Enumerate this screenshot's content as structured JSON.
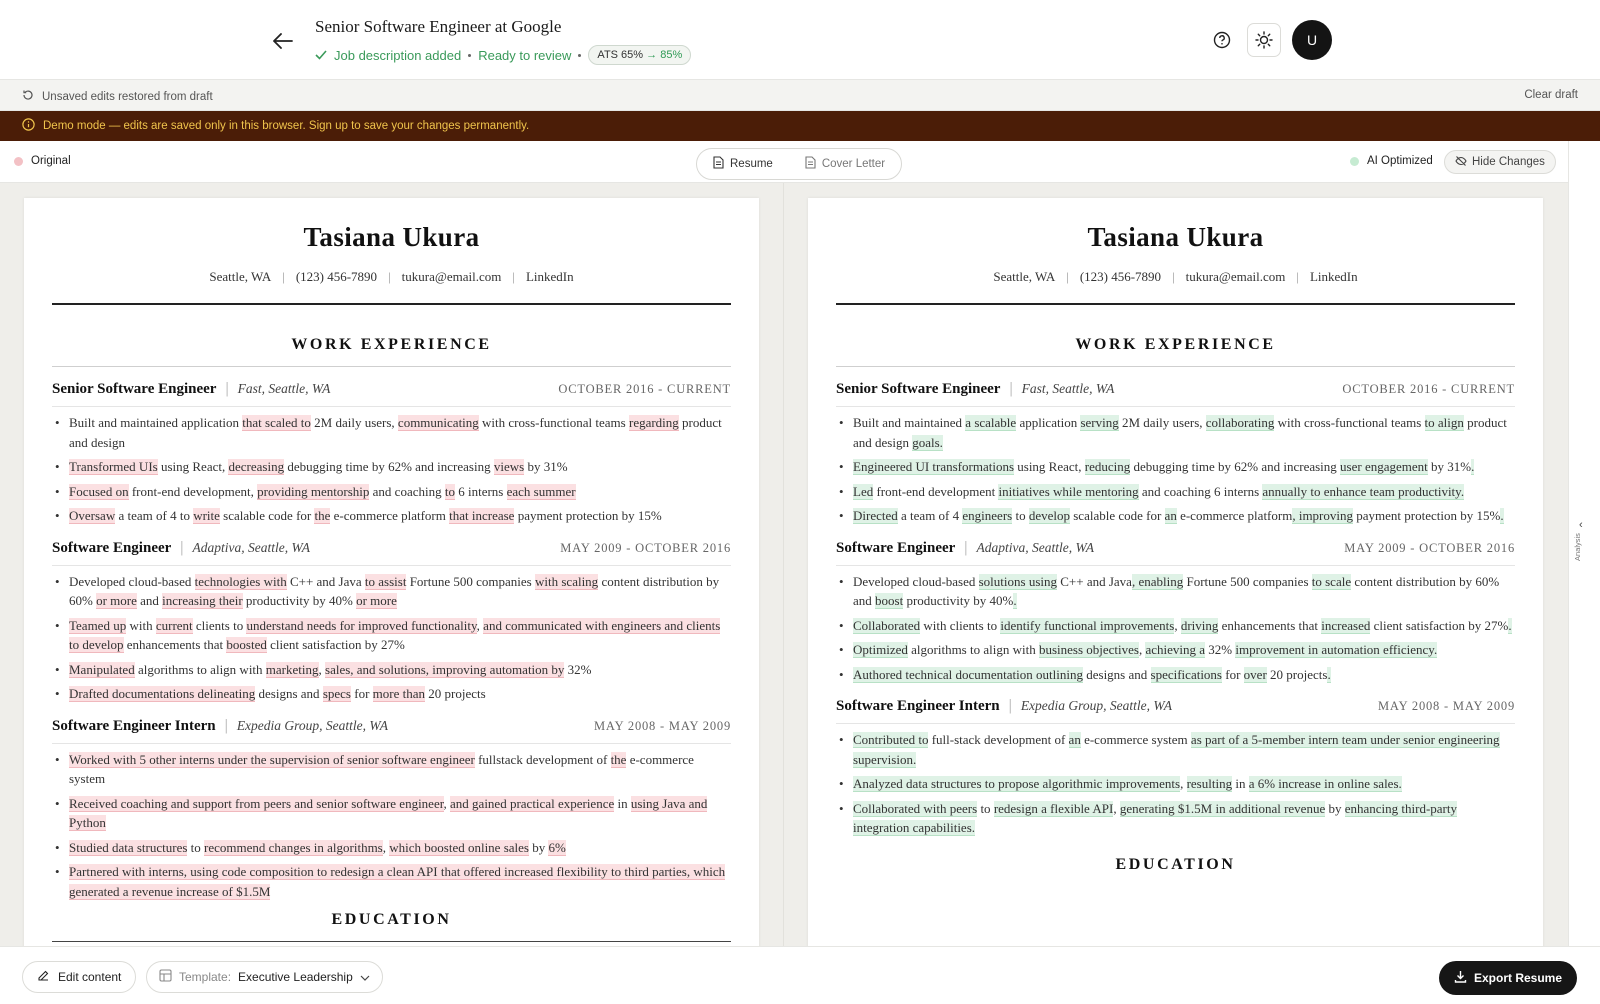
{
  "header": {
    "title": "Senior Software Engineer at Google",
    "status_jd": "Job description added",
    "status_ready": "Ready to review",
    "ats_label": "ATS 65%",
    "ats_arrow": "→",
    "ats_new": "85%",
    "avatar": "U"
  },
  "draft": {
    "message": "Unsaved edits restored from draft",
    "clear": "Clear draft"
  },
  "demo": {
    "message": "Demo mode — edits are saved only in this browser. Sign up to save your changes permanently."
  },
  "toolbar": {
    "original": "Original",
    "tab_resume": "Resume",
    "tab_cover": "Cover Letter",
    "ai": "AI Optimized",
    "hide": "Hide Changes",
    "original_dot": "#f3c1c5",
    "ai_dot": "#c6ebd2"
  },
  "rail": {
    "label": "Analysis"
  },
  "resume": {
    "name": "Tasiana Ukura",
    "contact": [
      "Seattle, WA",
      "(123) 456-7890",
      "tukura@email.com",
      "LinkedIn"
    ],
    "sections": [
      "WORK EXPERIENCE",
      "EDUCATION"
    ]
  },
  "original_jobs": [
    {
      "title": "Senior Software Engineer",
      "company": "Fast, Seattle, WA",
      "dates": "OCTOBER 2016 - CURRENT",
      "bullets": [
        [
          [
            "Built and maintained application ",
            ""
          ],
          [
            "that scaled to",
            "d"
          ],
          [
            " 2M daily users, ",
            ""
          ],
          [
            "communicating",
            "d"
          ],
          [
            " with cross-functional teams ",
            ""
          ],
          [
            "regarding",
            "d"
          ],
          [
            " product and design",
            ""
          ]
        ],
        [
          [
            "Transformed UIs",
            "d"
          ],
          [
            " using React, ",
            ""
          ],
          [
            "decreasing",
            "d"
          ],
          [
            " debugging time by 62% and increasing ",
            ""
          ],
          [
            "views",
            "d"
          ],
          [
            " by 31%",
            ""
          ]
        ],
        [
          [
            "Focused on",
            "d"
          ],
          [
            " front-end development, ",
            ""
          ],
          [
            "providing mentorship",
            "d"
          ],
          [
            " and coaching ",
            ""
          ],
          [
            "to",
            "d"
          ],
          [
            " 6 interns ",
            ""
          ],
          [
            "each summer",
            "d"
          ]
        ],
        [
          [
            "Oversaw",
            "d"
          ],
          [
            " a team of 4 to ",
            ""
          ],
          [
            "write",
            "d"
          ],
          [
            " scalable code for ",
            ""
          ],
          [
            "the",
            "d"
          ],
          [
            " e-commerce platform ",
            ""
          ],
          [
            "that increase",
            "d"
          ],
          [
            " payment protection by 15%",
            ""
          ]
        ]
      ]
    },
    {
      "title": "Software Engineer",
      "company": "Adaptiva, Seattle, WA",
      "dates": "MAY 2009 - OCTOBER 2016",
      "bullets": [
        [
          [
            "Developed cloud-based ",
            ""
          ],
          [
            "technologies with",
            "d"
          ],
          [
            " C++ and Java ",
            ""
          ],
          [
            "to assist",
            "d"
          ],
          [
            " Fortune 500 companies ",
            ""
          ],
          [
            "with scaling",
            "d"
          ],
          [
            " content distribution by 60% ",
            ""
          ],
          [
            "or more",
            "d"
          ],
          [
            " and ",
            ""
          ],
          [
            "increasing their",
            "d"
          ],
          [
            " productivity by 40% ",
            ""
          ],
          [
            "or more",
            "d"
          ]
        ],
        [
          [
            "Teamed up",
            "d"
          ],
          [
            " with ",
            ""
          ],
          [
            "current",
            "d"
          ],
          [
            " clients to ",
            ""
          ],
          [
            "understand needs for improved functionality",
            "d"
          ],
          [
            ", ",
            ""
          ],
          [
            "and communicated with engineers and clients to develop",
            "d"
          ],
          [
            " enhancements that ",
            ""
          ],
          [
            "boosted",
            "d"
          ],
          [
            " client satisfaction by 27%",
            ""
          ]
        ],
        [
          [
            "Manipulated",
            "d"
          ],
          [
            " algorithms to align with ",
            ""
          ],
          [
            "marketing",
            "d"
          ],
          [
            ", ",
            ""
          ],
          [
            "sales, and solutions, improving automation by",
            "d"
          ],
          [
            " 32%",
            ""
          ]
        ],
        [
          [
            "Drafted documentations delineating",
            "d"
          ],
          [
            " designs and ",
            ""
          ],
          [
            "specs",
            "d"
          ],
          [
            " for ",
            ""
          ],
          [
            "more than",
            "d"
          ],
          [
            " 20 projects",
            ""
          ]
        ]
      ]
    },
    {
      "title": "Software Engineer Intern",
      "company": "Expedia Group, Seattle, WA",
      "dates": "MAY 2008 - MAY 2009",
      "bullets": [
        [
          [
            "Worked with 5 other interns under the supervision of senior software engineer",
            "d"
          ],
          [
            " fullstack development of ",
            ""
          ],
          [
            "the",
            "d"
          ],
          [
            " e-commerce system",
            ""
          ]
        ],
        [
          [
            "Received coaching and support from peers and senior software engineer",
            "d"
          ],
          [
            ", ",
            ""
          ],
          [
            "and gained practical experience",
            "d"
          ],
          [
            " in ",
            ""
          ],
          [
            "using Java and Python",
            "d"
          ]
        ],
        [
          [
            "Studied data structures",
            "d"
          ],
          [
            " to ",
            ""
          ],
          [
            "recommend changes in algorithms",
            "d"
          ],
          [
            ", ",
            ""
          ],
          [
            "which boosted online sales",
            "d"
          ],
          [
            " by ",
            ""
          ],
          [
            "6%",
            "d"
          ]
        ],
        [
          [
            "Partnered with interns, using code composition to redesign a clean API that offered increased flexibility to third parties, which generated a revenue increase of $1.5M",
            "d"
          ]
        ]
      ]
    }
  ],
  "optimized_jobs": [
    {
      "title": "Senior Software Engineer",
      "company": "Fast, Seattle, WA",
      "dates": "OCTOBER 2016 - CURRENT",
      "bullets": [
        [
          [
            "Built and maintained ",
            ""
          ],
          [
            "a scalable",
            "a"
          ],
          [
            " application ",
            ""
          ],
          [
            "serving",
            "a"
          ],
          [
            " 2M daily users, ",
            ""
          ],
          [
            "collaborating",
            "a"
          ],
          [
            " with cross-functional teams ",
            ""
          ],
          [
            "to align",
            "a"
          ],
          [
            " product and design ",
            ""
          ],
          [
            "goals.",
            "a"
          ]
        ],
        [
          [
            "Engineered UI transformations",
            "a"
          ],
          [
            " using React, ",
            ""
          ],
          [
            "reducing",
            "a"
          ],
          [
            " debugging time by 62% and increasing ",
            ""
          ],
          [
            "user engagement",
            "a"
          ],
          [
            " by 31%",
            ""
          ],
          [
            ".",
            "a"
          ]
        ],
        [
          [
            "Led",
            "a"
          ],
          [
            " front-end development ",
            ""
          ],
          [
            "initiatives while mentoring",
            "a"
          ],
          [
            " and coaching 6 interns ",
            ""
          ],
          [
            "annually to enhance team productivity.",
            "a"
          ]
        ],
        [
          [
            "Directed",
            "a"
          ],
          [
            " a team of 4 ",
            ""
          ],
          [
            "engineers",
            "a"
          ],
          [
            " to ",
            ""
          ],
          [
            "develop",
            "a"
          ],
          [
            " scalable code for ",
            ""
          ],
          [
            "an",
            "a"
          ],
          [
            " e-commerce platform",
            ""
          ],
          [
            ", improving",
            "a"
          ],
          [
            " payment protection by 15%",
            ""
          ],
          [
            ".",
            "a"
          ]
        ]
      ]
    },
    {
      "title": "Software Engineer",
      "company": "Adaptiva, Seattle, WA",
      "dates": "MAY 2009 - OCTOBER 2016",
      "bullets": [
        [
          [
            "Developed cloud-based ",
            ""
          ],
          [
            "solutions using",
            "a"
          ],
          [
            " C++ and Java",
            ""
          ],
          [
            ", enabling",
            "a"
          ],
          [
            " Fortune 500 companies ",
            ""
          ],
          [
            "to scale",
            "a"
          ],
          [
            " content distribution by 60% and ",
            ""
          ],
          [
            "boost",
            "a"
          ],
          [
            " productivity by 40%",
            ""
          ],
          [
            ".",
            "a"
          ]
        ],
        [
          [
            "Collaborated",
            "a"
          ],
          [
            " with clients to ",
            ""
          ],
          [
            "identify functional improvements",
            "a"
          ],
          [
            ", ",
            ""
          ],
          [
            "driving",
            "a"
          ],
          [
            " enhancements that ",
            ""
          ],
          [
            "increased",
            "a"
          ],
          [
            " client satisfaction by 27%",
            ""
          ],
          [
            ".",
            "a"
          ]
        ],
        [
          [
            "Optimized",
            "a"
          ],
          [
            " algorithms to align with ",
            ""
          ],
          [
            "business objectives",
            "a"
          ],
          [
            ", ",
            ""
          ],
          [
            "achieving a",
            "a"
          ],
          [
            " 32% ",
            ""
          ],
          [
            "improvement in automation efficiency.",
            "a"
          ]
        ],
        [
          [
            "Authored technical documentation outlining",
            "a"
          ],
          [
            " designs and ",
            ""
          ],
          [
            "specifications",
            "a"
          ],
          [
            " for ",
            ""
          ],
          [
            "over",
            "a"
          ],
          [
            " 20 projects",
            ""
          ],
          [
            ".",
            "a"
          ]
        ]
      ]
    },
    {
      "title": "Software Engineer Intern",
      "company": "Expedia Group, Seattle, WA",
      "dates": "MAY 2008 - MAY 2009",
      "bullets": [
        [
          [
            "Contributed to",
            "a"
          ],
          [
            " full-stack development of ",
            ""
          ],
          [
            "an",
            "a"
          ],
          [
            " e-commerce system ",
            ""
          ],
          [
            "as part of a 5-member intern team under senior engineering supervision.",
            "a"
          ]
        ],
        [
          [
            "Analyzed data structures to propose algorithmic improvements",
            "a"
          ],
          [
            ", ",
            ""
          ],
          [
            "resulting",
            "a"
          ],
          [
            " in ",
            ""
          ],
          [
            "a 6% increase in online sales.",
            "a"
          ]
        ],
        [
          [
            "Collaborated with peers",
            "a"
          ],
          [
            " to ",
            ""
          ],
          [
            "redesign a flexible API",
            "a"
          ],
          [
            ", ",
            ""
          ],
          [
            "generating $1.5M in additional revenue",
            "a"
          ],
          [
            " by ",
            ""
          ],
          [
            "enhancing third-party integration capabilities.",
            "a"
          ]
        ]
      ]
    }
  ],
  "footer": {
    "edit": "Edit content",
    "template_label": "Template:",
    "template_value": "Executive Leadership",
    "export": "Export Resume"
  }
}
